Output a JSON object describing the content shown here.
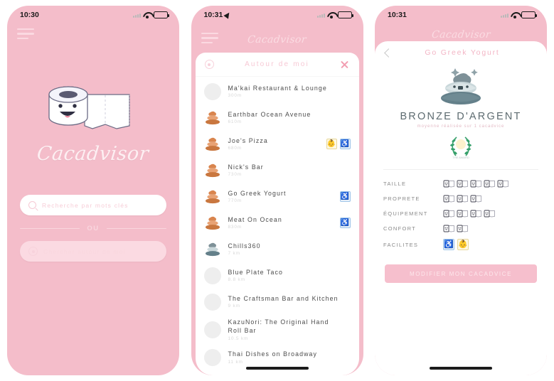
{
  "app": {
    "name": "Cacadvisor",
    "brand_pink": "#f4bdca",
    "accent_pink": "#f3b5c5"
  },
  "screen1": {
    "status": {
      "time": "10:30"
    },
    "menu_icon": "hamburger-menu-icon",
    "logo_text": "Cacadvisor",
    "mascot_icon": "toilet-paper-roll-icon",
    "search_keyword": {
      "icon": "search-icon",
      "placeholder": "Recherche par mots clés",
      "value": ""
    },
    "divider_label": "OU",
    "search_nearby": {
      "icon": "target-location-icon",
      "placeholder": "Chercher autour de moi",
      "value": ""
    }
  },
  "screen2": {
    "status": {
      "time": "10:31",
      "location_icon": "location-arrow-icon"
    },
    "menu_icon": "hamburger-menu-icon",
    "logo_text": "Cacadvisor",
    "sheet": {
      "locate_icon": "target-location-icon",
      "title": "Autour de moi",
      "close_icon": "close-icon"
    },
    "places": [
      {
        "name": "Ma'kai Restaurant & Lounge",
        "distance": "300m",
        "rated": false,
        "poop_color": "none",
        "badges": []
      },
      {
        "name": "Earthbar Ocean Avenue",
        "distance": "610m",
        "rated": true,
        "poop_color": "bronze",
        "badges": []
      },
      {
        "name": "Joe's Pizza",
        "distance": "680m",
        "rated": true,
        "poop_color": "bronze",
        "badges": [
          "baby-changing-icon",
          "wheelchair-icon"
        ]
      },
      {
        "name": "Nick's Bar",
        "distance": "730m",
        "rated": true,
        "poop_color": "bronze",
        "badges": []
      },
      {
        "name": "Go Greek Yogurt",
        "distance": "770m",
        "rated": true,
        "poop_color": "bronze",
        "badges": [
          "wheelchair-icon"
        ]
      },
      {
        "name": "Meat On Ocean",
        "distance": "830m",
        "rated": true,
        "poop_color": "bronze",
        "badges": [
          "wheelchair-icon"
        ]
      },
      {
        "name": "Chills360",
        "distance": "7 km",
        "rated": true,
        "poop_color": "silver",
        "badges": []
      },
      {
        "name": "Blue Plate Taco",
        "distance": "8.8 km",
        "rated": false,
        "poop_color": "none",
        "badges": []
      },
      {
        "name": "The Craftsman Bar and Kitchen",
        "distance": "9 km",
        "rated": false,
        "poop_color": "none",
        "badges": []
      },
      {
        "name": "KazuNori: The Original Hand Roll Bar",
        "distance": "10.5 km",
        "rated": false,
        "poop_color": "none",
        "badges": []
      },
      {
        "name": "Thai Dishes on Broadway",
        "distance": "11 km",
        "rated": false,
        "poop_color": "none",
        "badges": []
      }
    ]
  },
  "screen3": {
    "status": {
      "time": "10:31"
    },
    "logo_text": "Cacadvisor",
    "back_icon": "chevron-left-icon",
    "title": "Go Greek Yogurt",
    "mascot_icon": "silver-poop-icon",
    "rank_title": "BRONZE D'ARGENT",
    "rank_subtitle": "moyenne réalisée sur 1 cacadvice",
    "wreath_icon": "laurel-wreath-badge-icon",
    "wreath_label": "THE AWARD",
    "criteria": [
      {
        "label": "TAILLE",
        "value": 5,
        "max": 5,
        "icon": "toilet-paper-rating-icon"
      },
      {
        "label": "PROPRETE",
        "value": 3,
        "max": 3,
        "icon": "toilet-paper-rating-icon"
      },
      {
        "label": "ÉQUIPEMENT",
        "value": 4,
        "max": 4,
        "icon": "toilet-paper-rating-icon"
      },
      {
        "label": "CONFORT",
        "value": 2,
        "max": 2,
        "icon": "toilet-paper-rating-icon"
      }
    ],
    "facilities": {
      "label": "FACILITES",
      "items": [
        "wheelchair-icon",
        "baby-changing-icon"
      ]
    },
    "cta_label": "MODIFIER MON CACADVICE"
  }
}
